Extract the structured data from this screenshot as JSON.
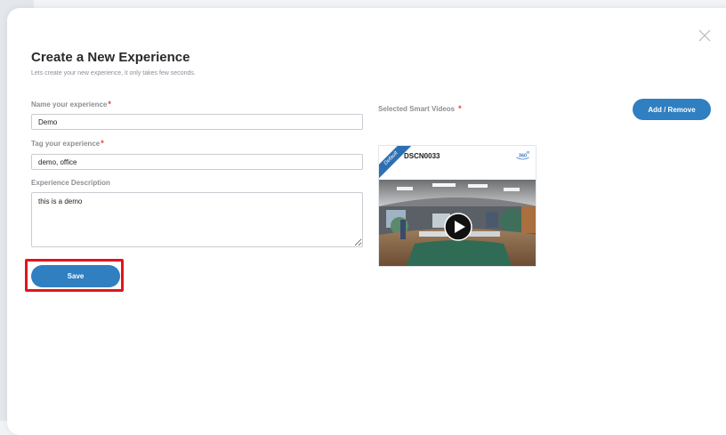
{
  "modal": {
    "title": "Create a New Experience",
    "subtitle": "Lets create your new experience, it only takes few seconds.",
    "close_icon": "close-icon"
  },
  "form": {
    "name_label": "Name your experience",
    "name_value": "Demo",
    "tag_label": "Tag your experience",
    "tag_value": "demo, office",
    "description_label": "Experience Description",
    "description_value": "this is a demo",
    "required_mark": "*",
    "save_label": "Save"
  },
  "videos": {
    "label": "Selected Smart Videos",
    "required_mark": "*",
    "add_remove_label": "Add / Remove",
    "items": [
      {
        "name": "DSCN0033",
        "ribbon": "Default",
        "badge_text": "360",
        "badge_icon": "360-icon",
        "play_icon": "play-icon"
      }
    ]
  },
  "colors": {
    "primary": "#2f7fc1",
    "ribbon": "#2d6fb3",
    "required": "#e0403a",
    "highlight": "#e2141c"
  }
}
